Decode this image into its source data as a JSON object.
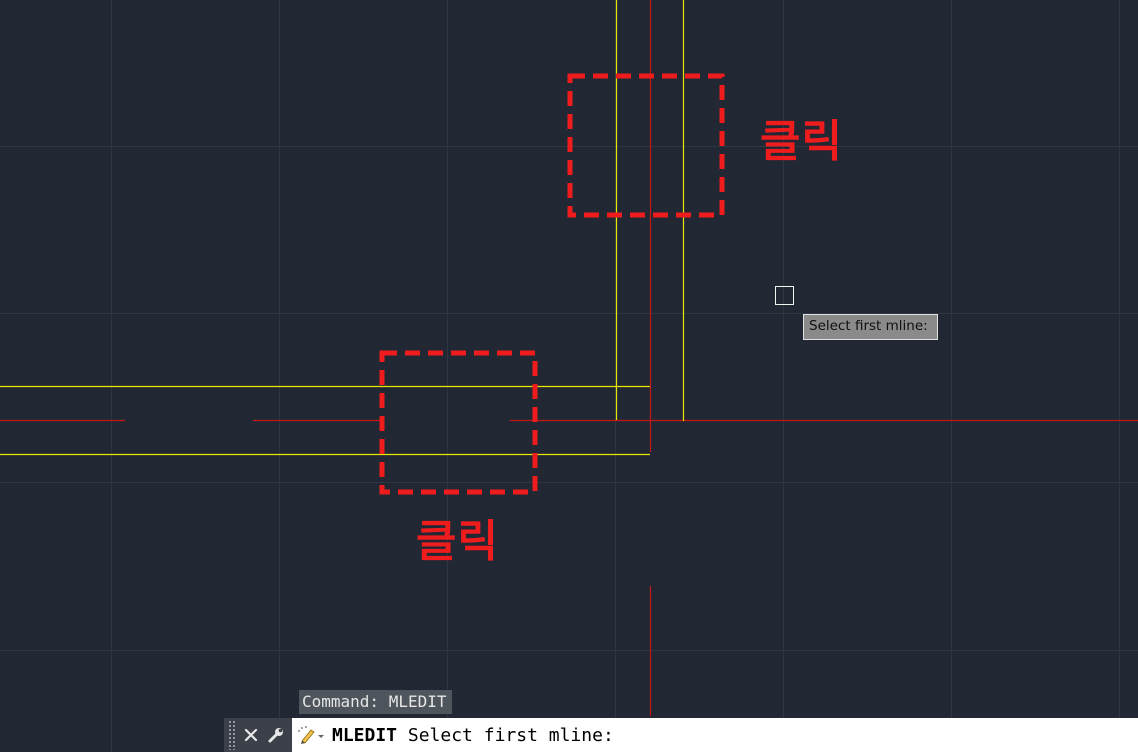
{
  "annotations": {
    "top_label": "클릭",
    "bottom_label": "클릭",
    "box_color": "#ee1c1c"
  },
  "tooltip": {
    "text": "Select first mline:"
  },
  "command_history": {
    "text": "Command: MLEDIT"
  },
  "command_line": {
    "command_name": "MLEDIT",
    "prompt": "Select first mline:",
    "close_icon": "close-icon",
    "customize_icon": "wrench-icon",
    "recent_icon": "pencil-prompt-icon"
  },
  "colors": {
    "background": "#212833",
    "mline": "#e6e600",
    "centerline": "#c41616",
    "grid": "#2e3642"
  }
}
